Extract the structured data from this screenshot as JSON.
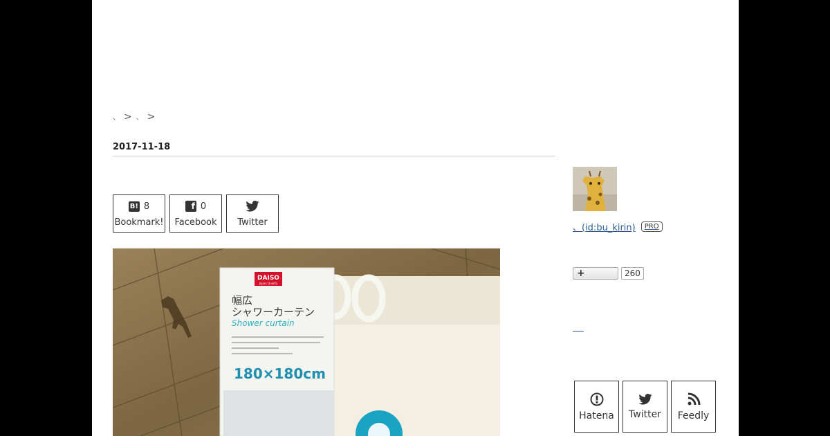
{
  "breadcrumb": {
    "items": [
      "、",
      "、"
    ],
    "separator": ">"
  },
  "entry": {
    "date": "2017-11-18"
  },
  "share": {
    "bookmark": {
      "icon": "hatena-bookmark-icon",
      "count": "8",
      "label": "Bookmark!"
    },
    "facebook": {
      "icon": "facebook-icon",
      "count": "0",
      "label": "Facebook"
    },
    "twitter": {
      "icon": "twitter-icon",
      "label": "Twitter"
    }
  },
  "photo": {
    "package_brand": "DAISO",
    "package_brand_sub": "Japan Quality",
    "package_title_line1": "幅広",
    "package_title_line2": "シャワーカーテン",
    "package_title_en": "Shower curtain",
    "package_size": "180×180cm"
  },
  "sidebar": {
    "profile_name": "、(id:bu_kirin)",
    "pro_badge": "PRO",
    "subscribe_label": "+",
    "subscribe_count": "260",
    "follow": [
      {
        "icon": "hatena-icon",
        "label": "Hatena"
      },
      {
        "icon": "twitter-icon",
        "label": "Twitter"
      },
      {
        "icon": "feedly-rss-icon",
        "label": "Feedly"
      }
    ]
  },
  "colors": {
    "background": "#000000",
    "page": "#ffffff",
    "link": "#2a5d8f",
    "border": "#333333"
  }
}
